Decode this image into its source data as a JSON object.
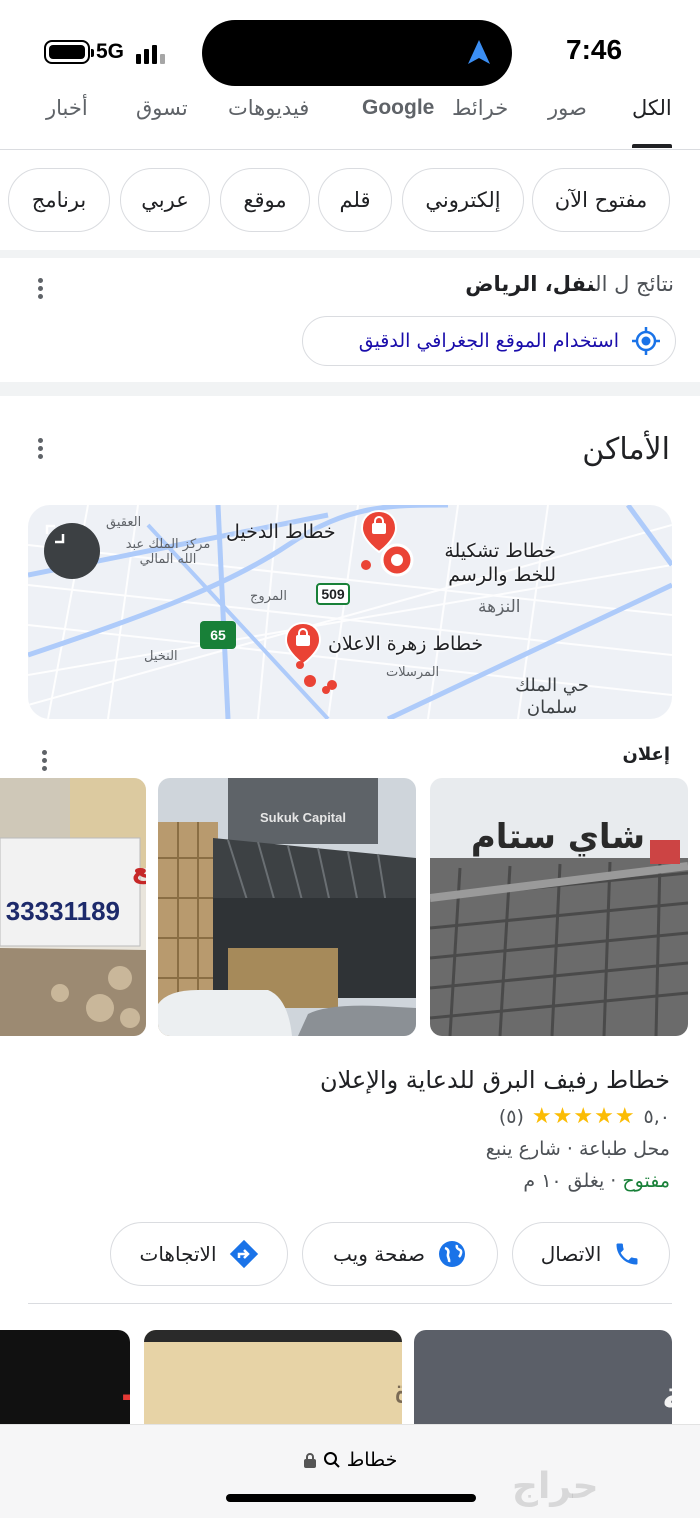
{
  "status_bar": {
    "time": "7:46",
    "network": "5G"
  },
  "tabs": [
    "الكل",
    "صور",
    "خرائط",
    "Google",
    "فيديوهات",
    "تسوق",
    "أخبار"
  ],
  "active_tab": "الكل",
  "chips": [
    "مفتوح الآن",
    "إلكتروني",
    "قلم",
    "موقع",
    "عربي",
    "برنامج"
  ],
  "results": {
    "prefix": "نتائج ل ال",
    "query": "نفل، الرياض"
  },
  "geo_button": "استخدام الموقع الجغرافي الدقيق",
  "places_title": "الأماكن",
  "map": {
    "places": [
      "خطاط الدخيل",
      "خطاط تشكيلة للخط والرسم",
      "خطاط زهرة الاعلان"
    ],
    "areas": [
      "العقيق",
      "مركز الملك عبد الله المالي",
      "المروج",
      "النزهة",
      "النخيل",
      "المرسلات",
      "حي الملك سلمان"
    ],
    "roads": [
      "509",
      "65"
    ]
  },
  "ad_label": "إعلان",
  "photos": {
    "shop_sign": "شاي ستام",
    "building_sign": "Sukuk Capital",
    "land_sign": "أرض للبيع",
    "land_phone": "33331189"
  },
  "business": {
    "name": "خطاط رفيف البرق للدعاية والإعلان",
    "rating": "٥,٠",
    "stars": "★★★★★",
    "reviews": "(٥)",
    "category": "محل طباعة · شارع ينبع",
    "status": "مفتوح",
    "closes": " · يغلق ١٠ م"
  },
  "actions": {
    "call": "الاتصال",
    "website": "صفحة ويب",
    "directions": "الاتجاهات"
  },
  "bottom_photos": [
    "استراحة خاصة",
    "خارج دائرة الأمارة",
    "خطاط"
  ],
  "url_bar": {
    "text": "خطاط"
  },
  "watermark": "حراج",
  "colors": {
    "google_blue": "#1a73e8",
    "pin_red": "#ea4335",
    "open_green": "#188038",
    "star_yellow": "#fbbc04"
  }
}
